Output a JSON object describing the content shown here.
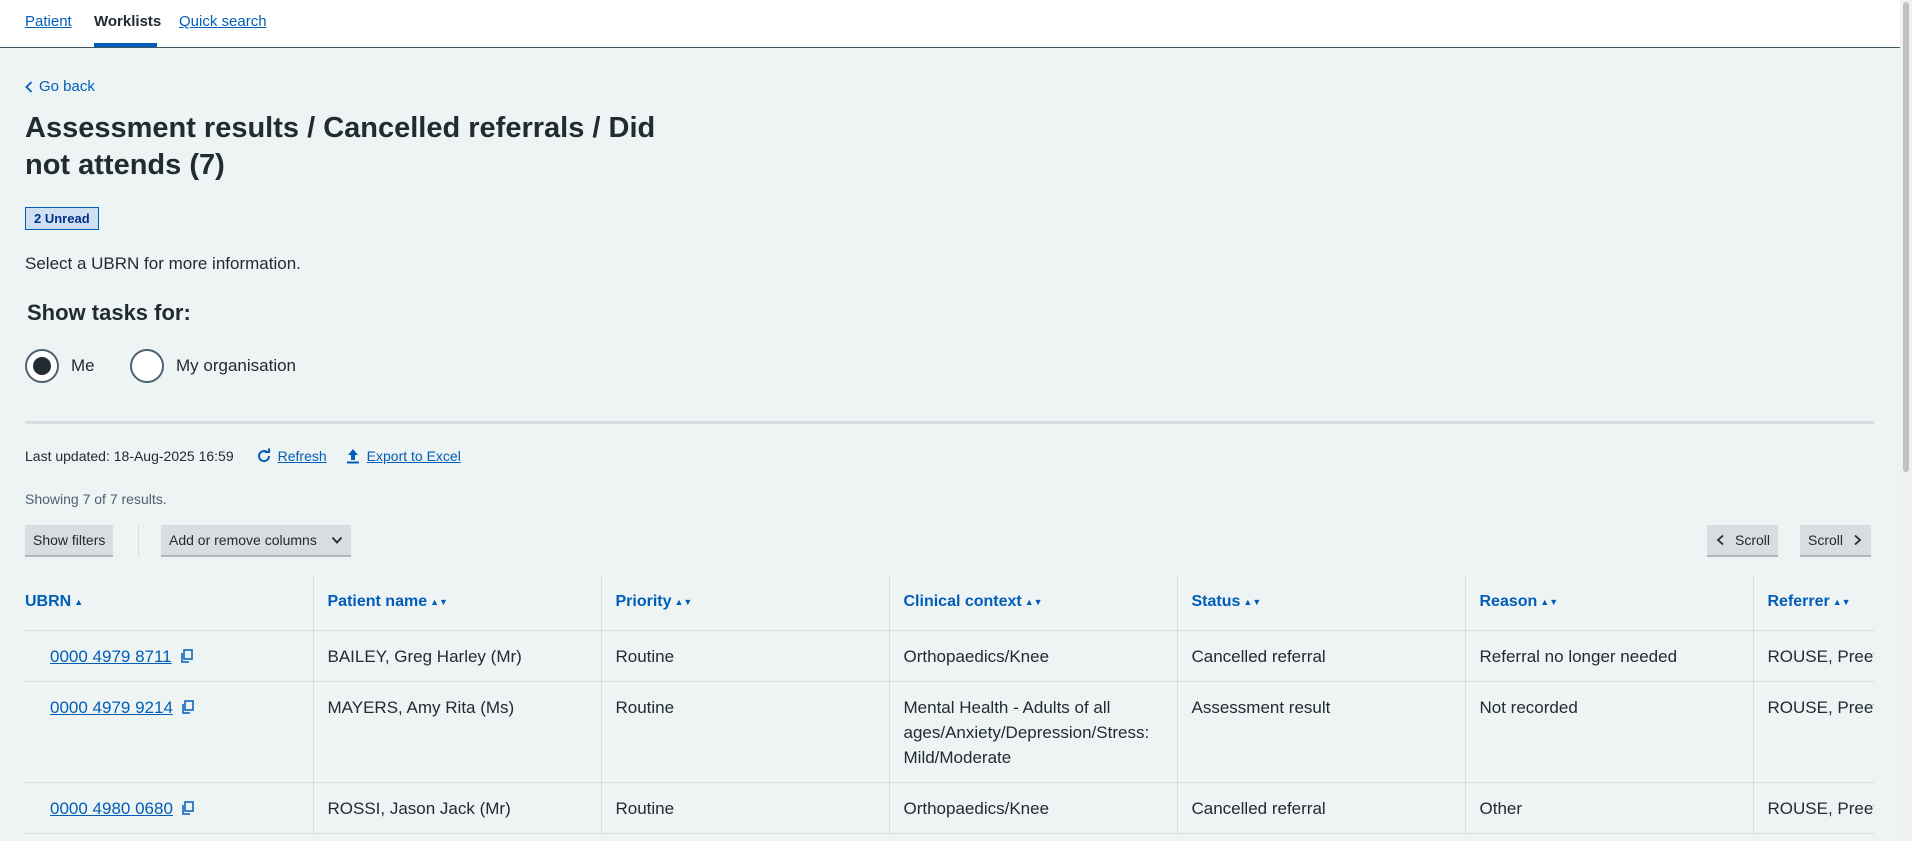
{
  "nav": {
    "tabs": [
      {
        "label": "Patient"
      },
      {
        "label": "Worklists"
      },
      {
        "label": "Quick search"
      }
    ]
  },
  "go_back": "Go back",
  "page_title": "Assessment results / Cancelled referrals / Did not attends (7)",
  "unread_badge": "2 Unread",
  "helper_text": "Select a UBRN for more information.",
  "show_tasks": {
    "label": "Show tasks for:",
    "options": [
      {
        "label": "Me",
        "selected": true
      },
      {
        "label": "My organisation",
        "selected": false
      }
    ]
  },
  "toolbar": {
    "last_updated": "Last updated: 18-Aug-2025 16:59",
    "refresh": "Refresh",
    "export": "Export to Excel",
    "results": "Showing 7 of 7 results.",
    "show_filters": "Show filters",
    "add_remove_columns": "Add or remove columns",
    "scroll_left": "Scroll",
    "scroll_right": "Scroll"
  },
  "table": {
    "columns": [
      "UBRN",
      "Patient name",
      "Priority",
      "Clinical context",
      "Status",
      "Reason",
      "Referrer"
    ],
    "rows": [
      {
        "ubrn": "0000 4979 8711",
        "patient": "BAILEY, Greg Harley (Mr)",
        "priority": "Routine",
        "context": "Orthopaedics/Knee",
        "status": "Cancelled referral",
        "reason": "Referral no longer needed",
        "referrer": "ROUSE, Preet"
      },
      {
        "ubrn": "0000 4979 9214",
        "patient": "MAYERS, Amy Rita (Ms)",
        "priority": "Routine",
        "context": "Mental Health - Adults of all ages/Anxiety/Depression/Stress: Mild/Moderate",
        "status": "Assessment result",
        "reason": "Not recorded",
        "referrer": "ROUSE, Preet"
      },
      {
        "ubrn": "0000 4980 0680",
        "patient": "ROSSI, Jason Jack (Mr)",
        "priority": "Routine",
        "context": "Orthopaedics/Knee",
        "status": "Cancelled referral",
        "reason": "Other",
        "referrer": "ROUSE, Preet"
      }
    ]
  },
  "colors": {
    "link": "#005eb8",
    "text": "#212b32",
    "background": "#eef3f4",
    "badge_bg": "#cfe0f2"
  }
}
